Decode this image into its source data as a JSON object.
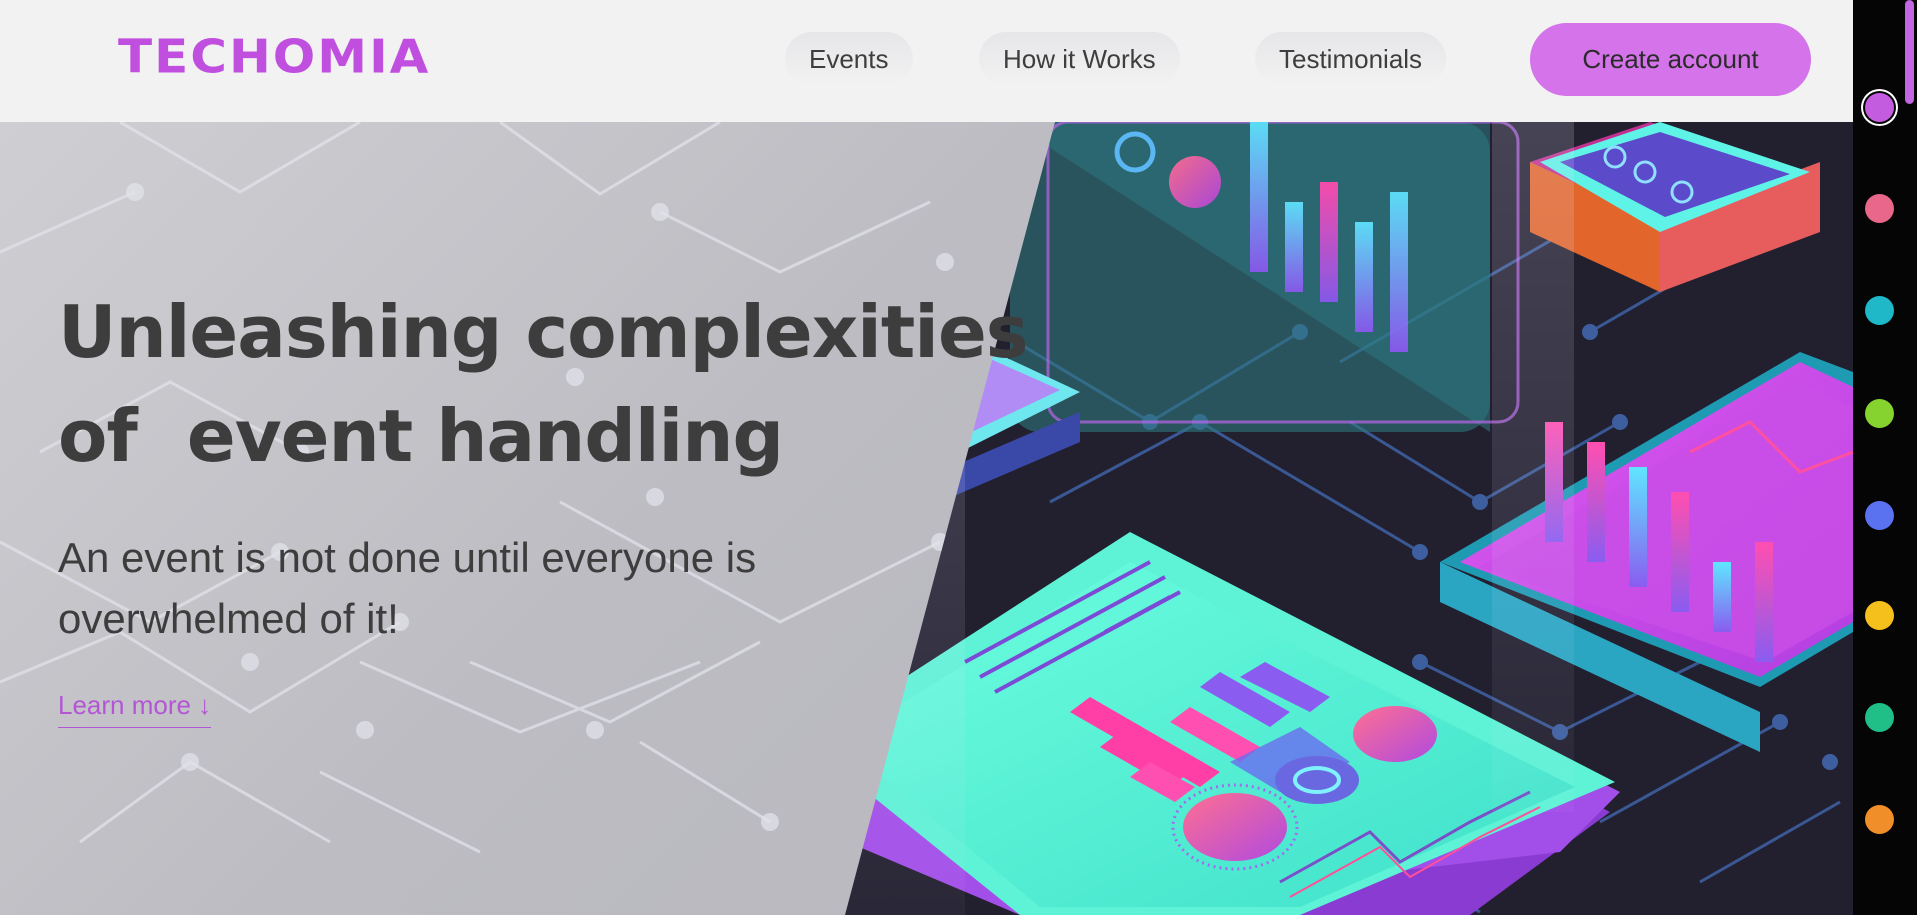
{
  "header": {
    "logo": "TECHOMIA",
    "nav": [
      "Events",
      "How it Works",
      "Testimonials"
    ],
    "cta": "Create account"
  },
  "hero": {
    "headline_line1_highlight": "Unleashing",
    "headline_line1_rest": "complexities",
    "headline_line2_plain": "of",
    "headline_line2_highlight": "event handling",
    "subtitle": "An event is not done until everyone is overwhelmed of it!",
    "learn_more": "Learn more ↓"
  },
  "theme_colors": [
    {
      "name": "purple",
      "hex": "#c45ce0",
      "active": true
    },
    {
      "name": "pink",
      "hex": "#e9678a",
      "active": false
    },
    {
      "name": "cyan",
      "hex": "#1eb8c9",
      "active": false
    },
    {
      "name": "green",
      "hex": "#86d32f",
      "active": false
    },
    {
      "name": "blue",
      "hex": "#5a72f0",
      "active": false
    },
    {
      "name": "yellow",
      "hex": "#f6c01c",
      "active": false
    },
    {
      "name": "teal",
      "hex": "#1fbf87",
      "active": false
    },
    {
      "name": "orange",
      "hex": "#f08e2a",
      "active": false
    }
  ],
  "accent_color": "#d473ea"
}
